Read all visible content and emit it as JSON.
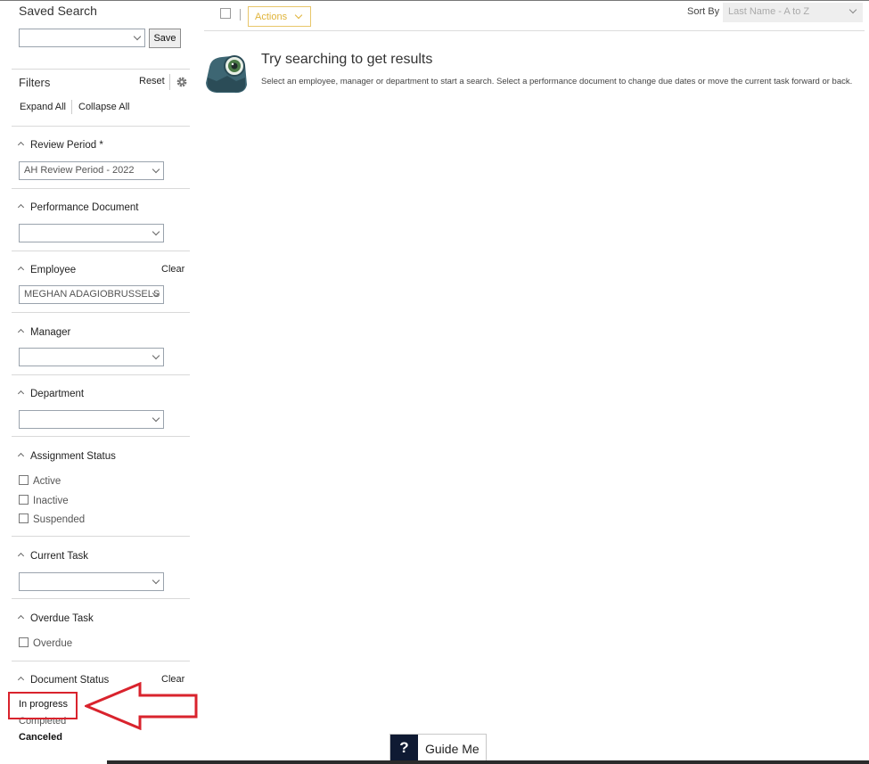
{
  "colors": {
    "accent": "#e0b43a",
    "annotation": "#d9232d",
    "guide_dark": "#0f1a33"
  },
  "sidebar": {
    "saved_search": {
      "title": "Saved Search",
      "select_value": "",
      "save_label": "Save"
    },
    "filters": {
      "title": "Filters",
      "reset_label": "Reset",
      "expand_all": "Expand All",
      "collapse_all": "Collapse All"
    },
    "review_period": {
      "label": "Review Period *",
      "value": "AH Review Period - 2022"
    },
    "performance_document": {
      "label": "Performance Document",
      "value": ""
    },
    "employee": {
      "label": "Employee",
      "clear_label": "Clear",
      "value": "MEGHAN ADAGIOBRUSSELS"
    },
    "manager": {
      "label": "Manager",
      "value": ""
    },
    "department": {
      "label": "Department",
      "value": ""
    },
    "assignment_status": {
      "label": "Assignment Status",
      "options": [
        "Active",
        "Inactive",
        "Suspended"
      ]
    },
    "current_task": {
      "label": "Current Task",
      "value": ""
    },
    "overdue_task": {
      "label": "Overdue Task",
      "option": "Overdue"
    },
    "document_status": {
      "label": "Document Status",
      "clear_label": "Clear",
      "items": [
        "In progress",
        "Completed",
        "Canceled"
      ]
    }
  },
  "toolbar": {
    "actions_label": "Actions",
    "sort_by_label": "Sort By",
    "sort_by_value": "Last Name - A to Z"
  },
  "empty_state": {
    "icon": "binoculars-icon",
    "title": "Try searching to get results",
    "description": "Select an employee, manager or department to start a search. Select a performance document to change due dates or move the current task forward or back."
  },
  "guide_me": {
    "icon_text": "?",
    "label": "Guide Me"
  }
}
